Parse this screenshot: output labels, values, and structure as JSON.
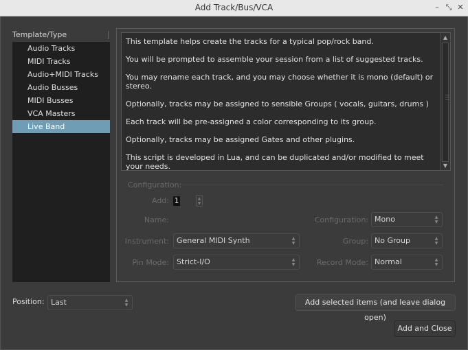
{
  "window": {
    "title": "Add Track/Bus/VCA"
  },
  "window_controls": {
    "minimize": "–",
    "restore": "⤡",
    "close": "✕"
  },
  "template_list": {
    "header": "Template/Type",
    "items": [
      {
        "label": "Audio Tracks"
      },
      {
        "label": "MIDI Tracks"
      },
      {
        "label": "Audio+MIDI Tracks"
      },
      {
        "label": "Audio Busses"
      },
      {
        "label": "MIDI Busses"
      },
      {
        "label": "VCA Masters"
      },
      {
        "label": "Live Band"
      }
    ],
    "selected": "Live Band"
  },
  "description": {
    "paragraphs": [
      "This template helps create the tracks for a typical pop/rock band.",
      "You will be prompted to assemble your session from a list of suggested tracks.",
      "You may rename each track, and you may choose whether it is mono (default) or stereo.",
      "Optionally, tracks may be assigned to sensible Groups ( vocals, guitars, drums )",
      "Each track will be pre-assigned a color corresponding to its group.",
      "Optionally, tracks may be assigned Gates and other plugins.",
      "This script is developed in Lua, and can be duplicated and/or modified to meet your needs."
    ]
  },
  "configuration": {
    "legend": "Configuration:",
    "add_label": "Add:",
    "add_value": "1",
    "name_label": "Name:",
    "config_label": "Configuration:",
    "config_value": "Mono",
    "instrument_label": "Instrument:",
    "instrument_value": "General MIDI Synth",
    "group_label": "Group:",
    "group_value": "No Group",
    "pin_mode_label": "Pin Mode:",
    "pin_mode_value": "Strict-I/O",
    "record_mode_label": "Record Mode:",
    "record_mode_value": "Normal"
  },
  "position": {
    "label": "Position:",
    "value": "Last"
  },
  "buttons": {
    "add_selected": "Add selected items (and leave dialog open)",
    "add_and_close": "Add and Close"
  }
}
